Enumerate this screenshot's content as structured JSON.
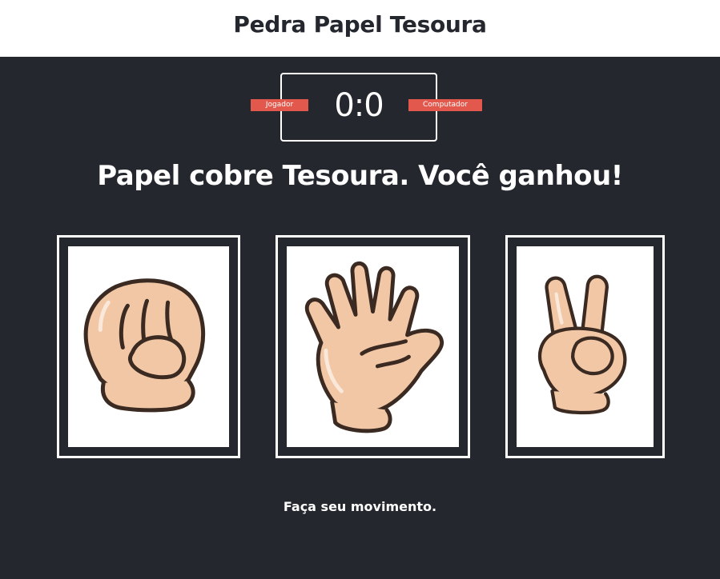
{
  "header": {
    "title": "Pedra Papel Tesoura"
  },
  "scoreboard": {
    "user_label": "Jogador",
    "computer_label": "Computador",
    "score": "0:0"
  },
  "result": {
    "message": "Papel cobre Tesoura. Você ganhou!"
  },
  "choices": [
    {
      "id": "rock",
      "icon": "rock-hand-icon"
    },
    {
      "id": "paper",
      "icon": "paper-hand-icon"
    },
    {
      "id": "scissors",
      "icon": "scissors-hand-icon"
    }
  ],
  "action": {
    "message": "Faça seu movimento."
  },
  "colors": {
    "background": "#24272e",
    "header": "#ffffff",
    "badge": "#e2584d",
    "skin": "#f2c7a5",
    "outline": "#3b2a21"
  }
}
